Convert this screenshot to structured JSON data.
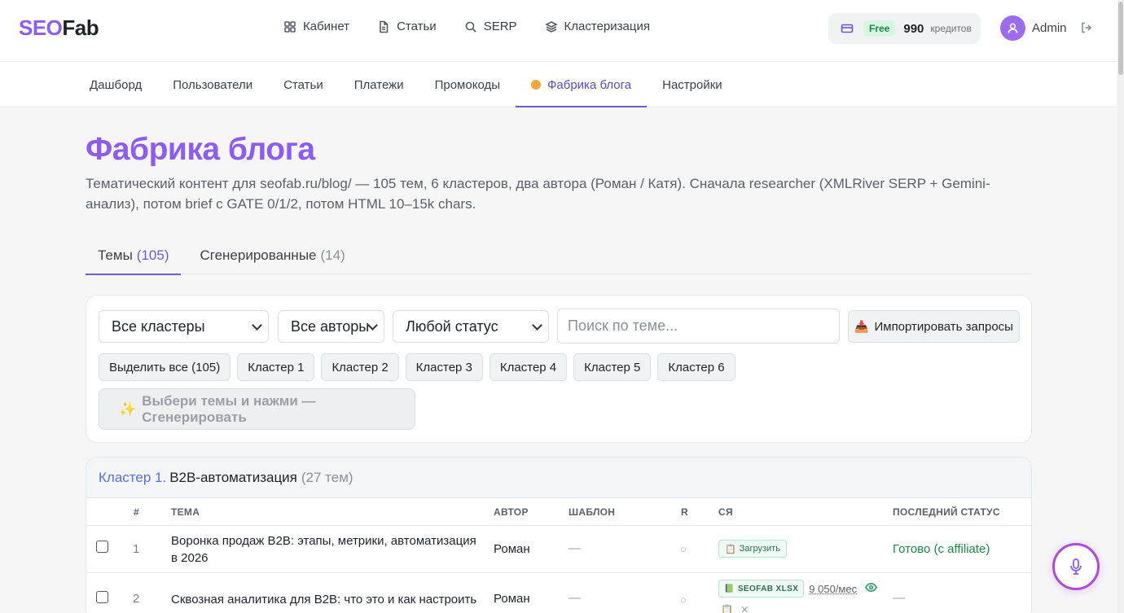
{
  "brand": {
    "part1": "SEO",
    "part2": "Fab"
  },
  "topnav": [
    {
      "label": "Кабинет",
      "icon": "grid-icon"
    },
    {
      "label": "Статьи",
      "icon": "document-icon"
    },
    {
      "label": "SERP",
      "icon": "search-icon"
    },
    {
      "label": "Кластеризация",
      "icon": "layers-icon"
    }
  ],
  "account": {
    "plan": "Free",
    "credits": "990",
    "credits_label": "кредитов",
    "user": "Admin"
  },
  "subnav": [
    {
      "label": "Дашборд"
    },
    {
      "label": "Пользователи"
    },
    {
      "label": "Статьи"
    },
    {
      "label": "Платежи"
    },
    {
      "label": "Промокоды"
    },
    {
      "label": "Фабрика блога",
      "active": true
    },
    {
      "label": "Настройки"
    }
  ],
  "page": {
    "title": "Фабрика блога",
    "subtitle": "Тематический контент для seofab.ru/blog/ — 105 тем, 6 кластеров, два автора (Роман / Катя). Сначала researcher (XMLRiver SERP + Gemini-анализ), потом brief с GATE 0/1/2, потом HTML 10–15k chars."
  },
  "content_tabs": [
    {
      "label": "Темы",
      "count": "(105)",
      "active": true
    },
    {
      "label": "Сгенерированные",
      "count": "(14)"
    }
  ],
  "filters": {
    "cluster": "Все кластеры",
    "author": "Все авторы",
    "status": "Любой статус",
    "search_placeholder": "Поиск по теме...",
    "import_label": "Импортировать запросы"
  },
  "chips": [
    "Выделить все (105)",
    "Кластер 1",
    "Кластер 2",
    "Кластер 3",
    "Кластер 4",
    "Кластер 5",
    "Кластер 6"
  ],
  "generate_label": "Выбери темы и нажми — Сгенерировать",
  "cluster": {
    "num": "Кластер 1.",
    "name": "B2B-автоматизация",
    "count": "(27 тем)",
    "columns": {
      "num": "#",
      "theme": "ТЕМА",
      "author": "АВТОР",
      "template": "ШАБЛОН",
      "r": "R",
      "sya": "СЯ",
      "status": "ПОСЛЕДНИЙ СТАТУС"
    },
    "rows": [
      {
        "num": "1",
        "theme": "Воронка продаж B2B: этапы, метрики, автоматизация в 2026",
        "author": "Роман",
        "template": "—",
        "r": "○",
        "sya_upload": "Загрузить",
        "status": "Готово (с affiliate)"
      },
      {
        "num": "2",
        "theme": "Сквозная аналитика для B2B: что это и как настроить",
        "author": "Роман",
        "template": "—",
        "r": "○",
        "sya_file": "SEOFAB XLSX",
        "sya_freq": "9 050/мес",
        "status": "—"
      }
    ]
  }
}
